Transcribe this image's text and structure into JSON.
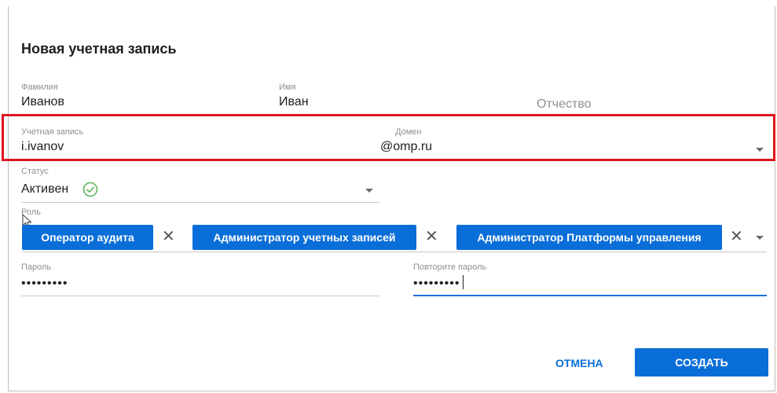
{
  "dialog": {
    "title": "Новая учетная запись"
  },
  "fields": {
    "last_name": {
      "label": "Фамилия",
      "value": "Иванов"
    },
    "first_name": {
      "label": "Имя",
      "value": "Иван"
    },
    "patronymic": {
      "placeholder": "Отчество"
    },
    "account": {
      "label": "Учетная запись",
      "value": "i.ivanov"
    },
    "domain": {
      "label": "Домен",
      "value": "@omp.ru"
    },
    "status": {
      "label": "Статус",
      "value": "Активен"
    },
    "role": {
      "label": "Роль",
      "chips": [
        "Оператор аудита",
        "Администратор учетных записей",
        "Администратор Платформы управления"
      ],
      "remove_glyph": "✕"
    },
    "password": {
      "label": "Пароль",
      "value": "•••••••••"
    },
    "password_repeat": {
      "label": "Повторите пароль",
      "value": "•••••••••"
    }
  },
  "buttons": {
    "cancel": "ОТМЕНА",
    "create": "СОЗДАТЬ"
  },
  "colors": {
    "accent": "#0a6ed9",
    "highlight": "#e0141e",
    "status_ok": "#5cb85c"
  },
  "icons": {
    "status": "check-circle-icon",
    "cursor": "mouse-pointer-icon"
  }
}
